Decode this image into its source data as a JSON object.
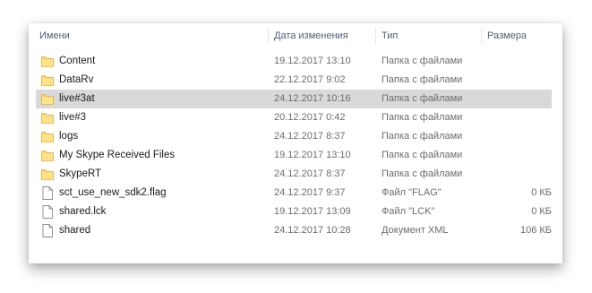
{
  "columns": {
    "name": "Имени",
    "date": "Дата изменения",
    "type": "Тип",
    "size": "Размера"
  },
  "rows": [
    {
      "name": "Content",
      "date": "19.12.2017 13:10",
      "type": "Папка с файлами",
      "size": "",
      "icon": "folder-icon"
    },
    {
      "name": "DataRv",
      "date": "22.12.2017 9:02",
      "type": "Папка с файлами",
      "size": "",
      "icon": "folder-icon"
    },
    {
      "name": "live#3at",
      "date": "24.12.2017 10:16",
      "type": "Папка с файлами",
      "size": "",
      "icon": "folder-icon",
      "selected": true
    },
    {
      "name": "live#3",
      "date": "20.12.2017 0:42",
      "type": "Папка с файлами",
      "size": "",
      "icon": "folder-icon"
    },
    {
      "name": "logs",
      "date": "24.12.2017 8:37",
      "type": "Папка с файлами",
      "size": "",
      "icon": "folder-icon"
    },
    {
      "name": "My Skype Received Files",
      "date": "19.12.2017 13:10",
      "type": "Папка с файлами",
      "size": "",
      "icon": "folder-icon"
    },
    {
      "name": "SkypeRT",
      "date": "24.12.2017 8:37",
      "type": "Папка с файлами",
      "size": "",
      "icon": "folder-icon"
    },
    {
      "name": "sct_use_new_sdk2.flag",
      "date": "24.12.2017 9:37",
      "type": "Файл \"FLAG\"",
      "size": "0 КБ",
      "icon": "file-icon"
    },
    {
      "name": "shared.lck",
      "date": "19.12.2017 13:09",
      "type": "Файл \"LCK\"",
      "size": "0 КБ",
      "icon": "file-icon"
    },
    {
      "name": "shared",
      "date": "24.12.2017 10:28",
      "type": "Документ XML",
      "size": "106 КБ",
      "icon": "file-icon"
    }
  ],
  "colors": {
    "folder": "#ffd86b",
    "selection": "#d9d9d9",
    "header_text": "#4c607a"
  }
}
